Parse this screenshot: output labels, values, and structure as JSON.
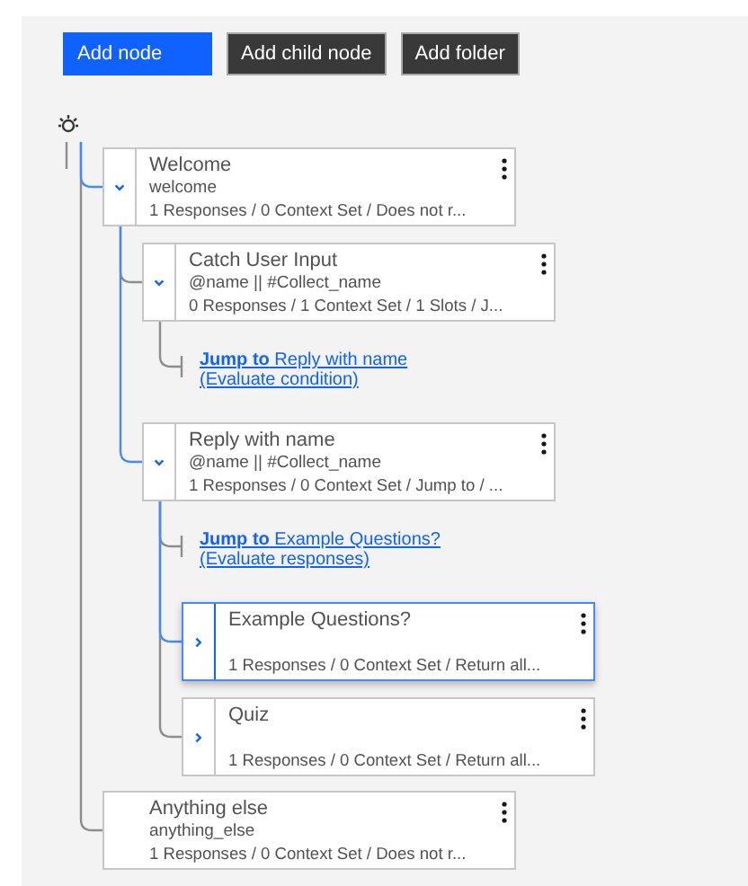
{
  "toolbar": [
    {
      "label": "Add node",
      "kind": "primary"
    },
    {
      "label": "Add child node",
      "kind": "secondary"
    },
    {
      "label": "Add folder",
      "kind": "secondary"
    }
  ],
  "nodes": [
    {
      "kind": "node",
      "title": "Welcome",
      "condition": "welcome",
      "summary": "1 Responses / 0 Context Set / Does not r...",
      "expanded": true,
      "selected": false,
      "children": [
        {
          "kind": "node",
          "title": "Catch User Input",
          "condition": "@name || #Collect_name",
          "summary": "0 Responses / 1 Context Set / 1 Slots / J...",
          "expanded": true,
          "selected": false,
          "children": [
            {
              "kind": "jump",
              "link": "**Jump to** Reply with name",
              "note": "(Evaluate condition)"
            }
          ]
        },
        {
          "kind": "node",
          "title": "Reply with name",
          "condition": "@name || #Collect_name",
          "summary": "1 Responses / 0 Context Set / Jump to / ...",
          "expanded": true,
          "selected": false,
          "children": [
            {
              "kind": "jump",
              "link": "**Jump to** Example Questions?",
              "note": "(Evaluate responses)"
            },
            {
              "kind": "node",
              "title": "Example Questions?",
              "summary": "1 Responses / 0 Context Set / Return all...",
              "expanded": false,
              "selected": true
            },
            {
              "kind": "node",
              "title": "Quiz",
              "summary": "1 Responses / 0 Context Set / Return all...",
              "expanded": false,
              "selected": false
            }
          ]
        }
      ]
    },
    {
      "kind": "node",
      "title": "Anything else",
      "condition": "anything_else",
      "summary": "1 Responses / 0 Context Set / Does not r...",
      "selected": false
    }
  ]
}
